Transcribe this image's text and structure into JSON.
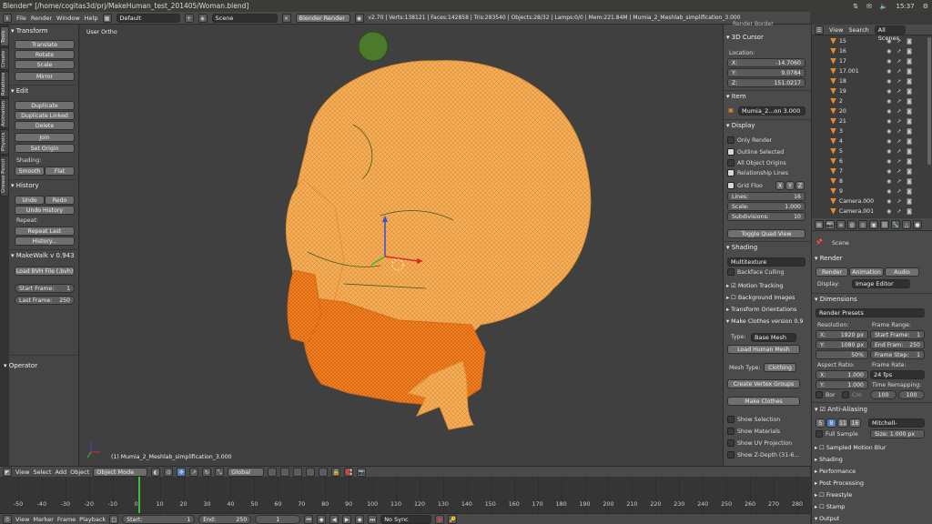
{
  "window": {
    "title": "Blender* [/home/cogitas3d/prj/MakeHuman_test_201405/Woman.blend]",
    "clock": "15:37"
  },
  "info_header": {
    "menus": [
      "File",
      "Render",
      "Window",
      "Help"
    ],
    "screen": "Default",
    "scene": "Scene",
    "engine": "Blender Render",
    "stats": "v2.70 | Verts:138121 | Faces:142858 | Tris:283540 | Objects:28/32 | Lamps:0/0 | Mem:221.84M | Mumia_2_Meshlab_simplification_3.000"
  },
  "tool_tabs": [
    "Tools",
    "Create",
    "Relations",
    "Animation",
    "Physics",
    "Grease Pencil"
  ],
  "tools": {
    "transform_header": "Transform",
    "translate": "Translate",
    "rotate": "Rotate",
    "scale": "Scale",
    "mirror": "Mirror",
    "edit_header": "Edit",
    "duplicate": "Duplicate",
    "duplicate_linked": "Duplicate Linked",
    "delete": "Delete",
    "join": "Join",
    "set_origin": "Set Origin",
    "shading_label": "Shading:",
    "smooth": "Smooth",
    "flat": "Flat",
    "history_header": "History",
    "undo": "Undo",
    "redo": "Redo",
    "undo_history": "Undo History",
    "repeat_label": "Repeat:",
    "repeat_last": "Repeat Last",
    "history_btn": "History...",
    "makewalk_header": "MakeWalk v 0.943",
    "load_bvh": "Load BVH File (.bvh)",
    "start_frame_label": "Start Frame:",
    "start_frame": "1",
    "last_frame_label": "Last Frame:",
    "last_frame": "250",
    "operator_header": "Operator"
  },
  "viewport": {
    "view_name": "User Ortho",
    "object_label": "(1) Mumia_2_Meshlab_simplification_3.000",
    "model_color": "#f5a84a"
  },
  "n_panel": {
    "top_cut": "Render Border",
    "cursor_header": "3D Cursor",
    "location_label": "Location:",
    "x_label": "X:",
    "x": "-14.7060",
    "y_label": "Y:",
    "y": "9.0784",
    "z_label": "Z:",
    "z": "151.0217",
    "item_header": "Item",
    "item_name": "Mumia_2...on 3.000",
    "display_header": "Display",
    "only_render": "Only Render",
    "outline_selected": "Outline Selected",
    "all_origins": "All Object Origins",
    "relationship_lines": "Relationship Lines",
    "grid_floor": "Grid Floo",
    "axes": [
      "X",
      "Y",
      "Z"
    ],
    "lines_label": "Lines:",
    "lines": "16",
    "scale_label": "Scale:",
    "scale": "1.000",
    "subdiv_label": "Subdivisions:",
    "subdiv": "10",
    "toggle_quad": "Toggle Quad View",
    "shading_header": "Shading",
    "shading_mode": "Multitexture",
    "backface": "Backface Culling",
    "motion_tracking": "Motion Tracking",
    "background_images": "Background Images",
    "transform_orient": "Transform Orientations",
    "make_clothes_header": "Make Clothes version 0.9",
    "type_label": "Type:",
    "type_value": "Base Mesh",
    "load_human": "Load Human Mesh",
    "mesh_type_label": "Mesh Type:",
    "mesh_type_value": "Clothing",
    "create_vgroups": "Create Vertex Groups",
    "make_clothes": "Make Clothes",
    "show_selection": "Show Selection",
    "show_materials": "Show Materials",
    "show_uv": "Show UV Projection",
    "show_zdepth": "Show Z-Depth (31-6..."
  },
  "outliner": {
    "menus": [
      "View",
      "Search",
      "All Scenes"
    ],
    "rows": [
      "15",
      "16",
      "17",
      "17.001",
      "18",
      "19",
      "2",
      "20",
      "21",
      "3",
      "4",
      "5",
      "6",
      "7",
      "8",
      "9",
      "Camera.000",
      "Camera.001"
    ]
  },
  "properties": {
    "scene_crumb": "Scene",
    "render_header": "Render",
    "render_btn": "Render",
    "animation_btn": "Animation",
    "audio_btn": "Audio",
    "display_label": "Display:",
    "display_value": "Image Editor",
    "dimensions_header": "Dimensions",
    "presets": "Render Presets",
    "resolution_label": "Resolution:",
    "res_x_label": "X:",
    "res_x": "1920 px",
    "res_y_label": "Y:",
    "res_y": "1080 px",
    "res_pct": "50%",
    "frame_range_label": "Frame Range:",
    "start_frame_label": "Start Frame:",
    "start_frame": "1",
    "end_frame_label": "End Fram:",
    "end_frame": "250",
    "frame_step_label": "Frame Step:",
    "frame_step": "1",
    "aspect_label": "Aspect Ratio:",
    "asp_x_label": "X:",
    "asp_x": "1.000",
    "asp_y_label": "Y:",
    "asp_y": "1.000",
    "frame_rate_label": "Frame Rate:",
    "frame_rate": "24 fps",
    "bor": "Bor",
    "cro": "Cro",
    "time_remap_label": "Time Remapping:",
    "remap_old": "100",
    "remap_new": "100",
    "aa_header": "Anti-Aliasing",
    "aa_samples": [
      "5",
      "8",
      "11",
      "16"
    ],
    "aa_filter": "Mitchell-Netrav...",
    "full_sample": "Full Sample",
    "aa_size": "Size: 1.000 px",
    "sampled_mb": "Sampled Motion Blur",
    "collapsed": [
      "Shading",
      "Performance",
      "Post Processing",
      "Freestyle",
      "Stamp",
      "Output"
    ]
  },
  "view3d_header": {
    "menus": [
      "View",
      "Select",
      "Add",
      "Object"
    ],
    "mode": "Object Mode",
    "orientation": "Global"
  },
  "timeline": {
    "ticks": [
      "-50",
      "-40",
      "-30",
      "-20",
      "-10",
      "0",
      "10",
      "20",
      "30",
      "40",
      "50",
      "60",
      "70",
      "80",
      "90",
      "100",
      "110",
      "120",
      "130",
      "140",
      "150",
      "160",
      "170",
      "180",
      "190",
      "200",
      "210",
      "220",
      "230",
      "240",
      "250",
      "260",
      "270",
      "280"
    ],
    "current_frame": 1
  },
  "timeline_header": {
    "menus": [
      "View",
      "Marker",
      "Frame",
      "Playback"
    ],
    "start_label": "Start:",
    "start": "1",
    "end_label": "End:",
    "end": "250",
    "current": "1",
    "sync": "No Sync"
  }
}
